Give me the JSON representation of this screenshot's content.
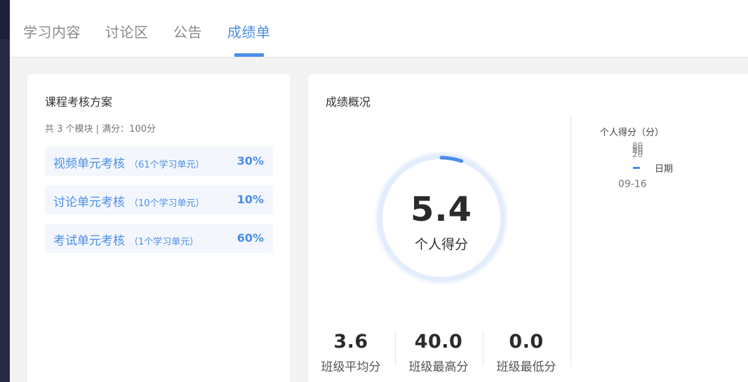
{
  "tabs": [
    {
      "label": "学习内容",
      "active": false
    },
    {
      "label": "讨论区",
      "active": false
    },
    {
      "label": "公告",
      "active": false
    },
    {
      "label": "成绩单",
      "active": true
    }
  ],
  "scheme": {
    "title": "课程考核方案",
    "summary": "共 3 个模块 | 满分：100分",
    "modules": [
      {
        "name": "视频单元考核",
        "count": "（61个学习单元）",
        "percent": "30%"
      },
      {
        "name": "讨论单元考核",
        "count": "（10个学习单元）",
        "percent": "10%"
      },
      {
        "name": "考试单元考核",
        "count": "（1个学习单元）",
        "percent": "60%"
      }
    ]
  },
  "overview": {
    "title": "成绩概况",
    "personal_score": "5.4",
    "personal_label": "个人得分",
    "progress_fraction": 0.054,
    "stats": [
      {
        "value": "3.6",
        "label": "班级平均分"
      },
      {
        "value": "40.0",
        "label": "班级最高分"
      },
      {
        "value": "0.0",
        "label": "班级最低分"
      }
    ]
  },
  "mini_chart": {
    "ylabel": "个人得分（分）",
    "tick_text": "80\n60\n40\n20",
    "legend": "日期",
    "date": "09-16"
  },
  "colors": {
    "accent": "#4a8de8",
    "sidebar": "#262a45"
  }
}
